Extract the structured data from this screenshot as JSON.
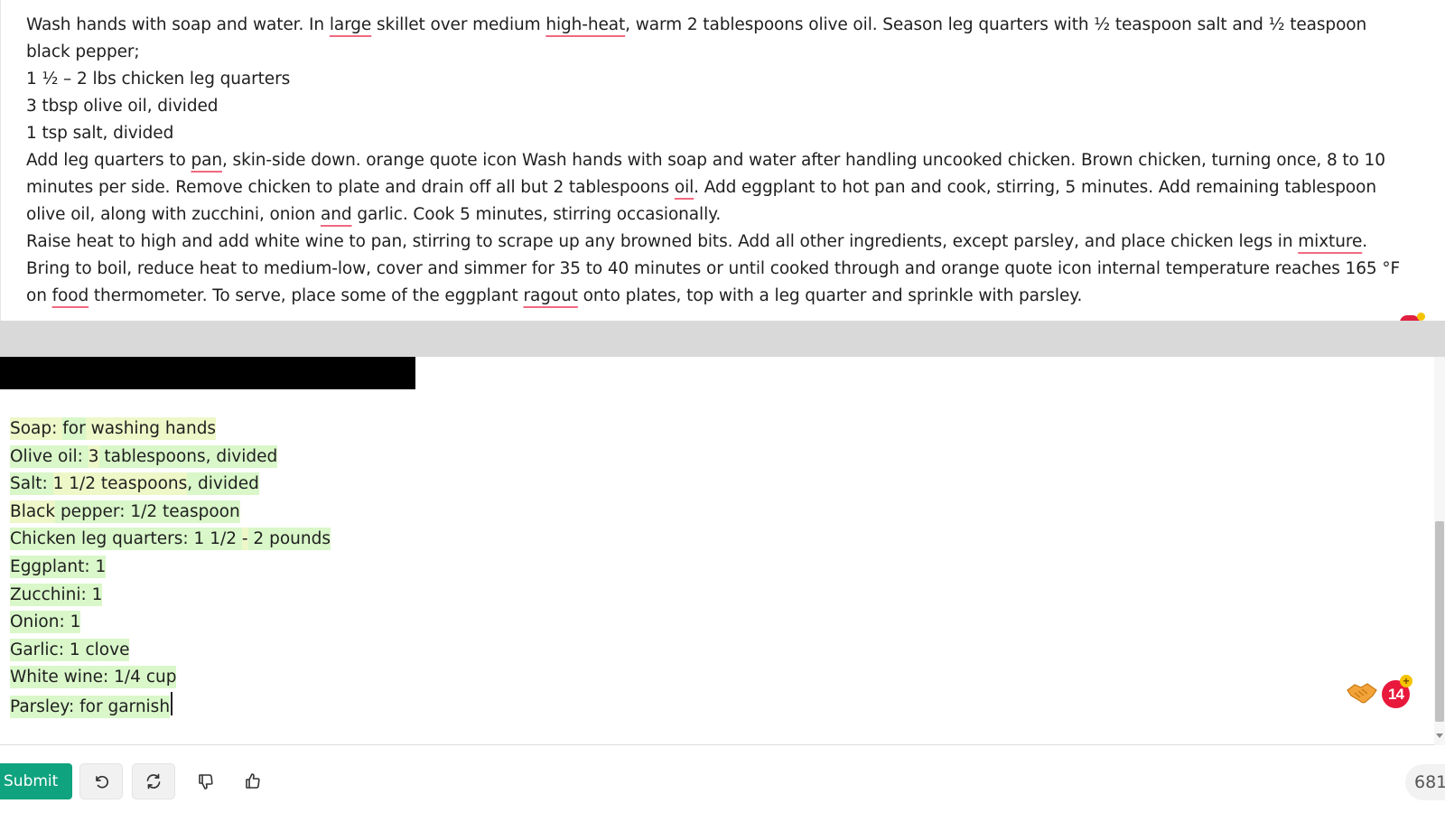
{
  "source": {
    "paragraphs": [
      [
        {
          "t": "Wash hands with soap and water. In "
        },
        {
          "t": "large",
          "sp": true
        },
        {
          "t": " skillet over medium "
        },
        {
          "t": "high-heat",
          "sp": true
        },
        {
          "t": ", warm 2 tablespoons olive oil. Season leg quarters with ½ teaspoon salt and ½ teaspoon black pepper;"
        }
      ],
      [
        {
          "t": "1 ½ – 2 lbs chicken leg quarters"
        }
      ],
      [
        {
          "t": "3 tbsp olive oil, divided"
        }
      ],
      [
        {
          "t": "1 tsp salt, divided"
        }
      ],
      [
        {
          "t": "Add leg quarters to "
        },
        {
          "t": "pan",
          "sp": true
        },
        {
          "t": ", skin-side down. orange quote icon Wash hands with soap and water after handling uncooked chicken. Brown chicken, turning once, 8 to 10 minutes per side. Remove chicken to plate and drain off all but 2 tablespoons "
        },
        {
          "t": "oil",
          "sp": true
        },
        {
          "t": ". Add eggplant to hot pan and cook, stirring, 5 minutes. Add remaining tablespoon olive oil, along with zucchini, onion "
        },
        {
          "t": "and",
          "sp": true
        },
        {
          "t": " garlic. Cook 5 minutes, stirring occasionally."
        }
      ],
      [
        {
          "t": "Raise heat to high and add white wine to pan, stirring to scrape up any browned bits. Add all other ingredients, except parsley, and place chicken legs in "
        },
        {
          "t": "mixture",
          "sp": true
        },
        {
          "t": ". Bring  to boil, reduce heat to medium-low, cover and simmer for 35 to 40 minutes or until cooked through and orange quote icon internal temperature reaches 165 °F on "
        },
        {
          "t": "food",
          "sp": true
        },
        {
          "t": " thermometer. To serve, place some of the eggplant "
        },
        {
          "t": "ragout",
          "sp": true
        },
        {
          "t": " onto plates, top with a leg quarter and sprinkle with parsley."
        }
      ]
    ]
  },
  "editor": {
    "ingredients": [
      [
        {
          "t": "Soap: ",
          "h": "y"
        },
        {
          "t": "for",
          "h": "g"
        },
        {
          "t": " washing hands",
          "h": "y"
        }
      ],
      [
        {
          "t": "Olive oil: ",
          "h": "g"
        },
        {
          "t": "3",
          "h": "y"
        },
        {
          "t": " tablespoons, divided",
          "h": "g"
        }
      ],
      [
        {
          "t": "Salt: ",
          "h": "g"
        },
        {
          "t": "1 1/2 teaspoons",
          "h": "y"
        },
        {
          "t": ", divided",
          "h": "g"
        }
      ],
      [
        {
          "t": "Black",
          "h": "y"
        },
        {
          "t": " pepper: 1/2 teaspoon",
          "h": "g"
        }
      ],
      [
        {
          "t": "Chicken leg quarters: 1 1/2 ",
          "h": "g"
        },
        {
          "t": "-",
          "h": "y"
        },
        {
          "t": " 2 pounds",
          "h": "g"
        }
      ],
      [
        {
          "t": "Eggplant: 1",
          "h": "g"
        }
      ],
      [
        {
          "t": "Zucchini: 1",
          "h": "g"
        }
      ],
      [
        {
          "t": "Onion: 1",
          "h": "g"
        }
      ],
      [
        {
          "t": "Garlic: 1 clove",
          "h": "g"
        }
      ],
      [
        {
          "t": "White wine: 1/4 cup",
          "h": "g"
        }
      ],
      [
        {
          "t": "Parsley: for garnish",
          "h": "g"
        }
      ]
    ],
    "notification_count": "14",
    "notification_plus": "+"
  },
  "toolbar": {
    "submit_label": "Submit",
    "count_label": "681",
    "icons": [
      "undo-icon",
      "refresh-icon",
      "thumbs-down-icon",
      "thumbs-up-icon"
    ]
  },
  "colors": {
    "accent": "#10a37f",
    "highlight_green": "#d9f7c9",
    "highlight_yellow": "#eef7c8",
    "spell_underline": "#f06a80",
    "badge_red": "#e8193c"
  }
}
